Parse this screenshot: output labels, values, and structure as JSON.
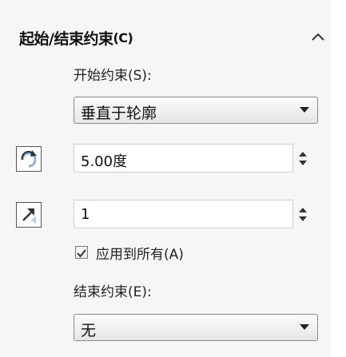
{
  "section": {
    "title_main": "起始/结束约束",
    "title_suffix": "(C)",
    "collapse_icon": "chevron-up-icon"
  },
  "start_constraint": {
    "label": "开始约束(S):",
    "selected": "垂直于轮廓"
  },
  "angle": {
    "icon": "rotate-icon",
    "value": "5.00度"
  },
  "tangent_length": {
    "icon": "arrow-up-left-icon",
    "value": "1"
  },
  "apply_all": {
    "label": "应用到所有(A)",
    "checked": true
  },
  "end_constraint": {
    "label": "结束约束(E):",
    "selected": "无"
  },
  "colors": {
    "panel_bg": "#f6f6f6",
    "input_border": "#cfcfcf",
    "icon_blue": "#7ea8c9"
  }
}
